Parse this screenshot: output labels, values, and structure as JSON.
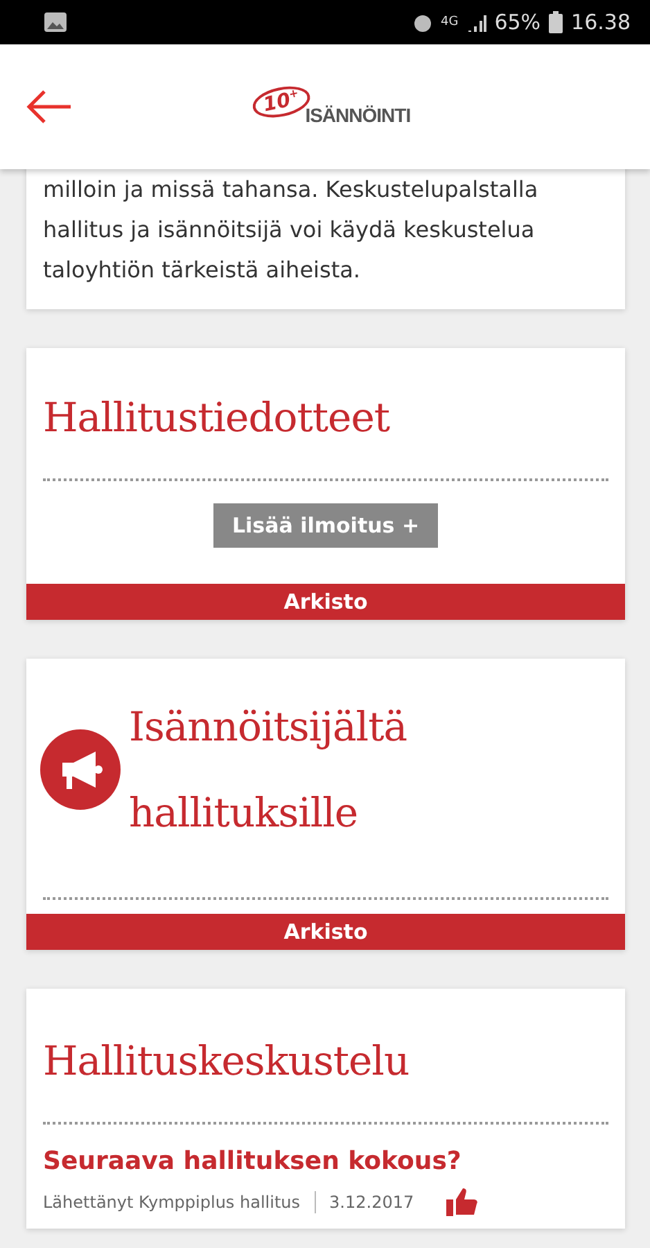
{
  "status_bar": {
    "network": "4G",
    "battery": "65%",
    "time": "16.38"
  },
  "header": {
    "logo_badge": "10",
    "logo_sup": "+",
    "logo_text": "ISÄNNÖINTI"
  },
  "intro_card": {
    "text": "milloin ja missä tahansa. Keskustelupalstalla hallitus ja isännöitsijä voi käydä keskustelua taloyhtiön tärkeistä aiheista."
  },
  "sections": [
    {
      "kind": "notices",
      "title": "Hallitustiedotteet",
      "button": "Lisää ilmoitus +",
      "archive": "Arkisto"
    },
    {
      "kind": "announcements",
      "title_lines": [
        "Isännöitsijältä",
        "hallituksille"
      ],
      "archive": "Arkisto"
    },
    {
      "kind": "discussion",
      "title": "Hallituskeskustelu",
      "posts": [
        {
          "title": "Seuraava hallituksen kokous?",
          "author": "Lähettänyt Kymppiplus hallitus",
          "date": "3.12.2017",
          "liked": true
        }
      ]
    }
  ]
}
